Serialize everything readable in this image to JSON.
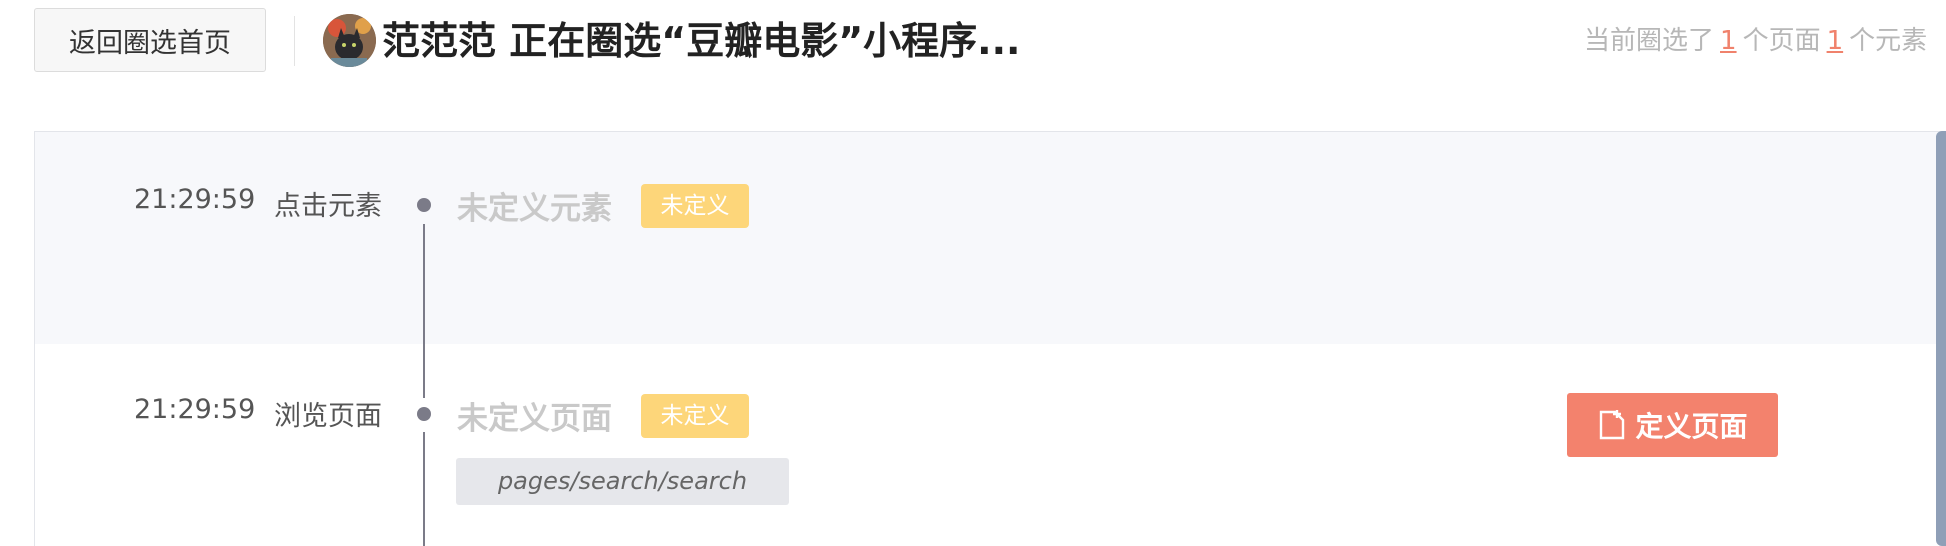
{
  "header": {
    "back_label": "返回圈选首页",
    "title": "范范范 正在圈选“豆瓣电影”小程序...",
    "summary_prefix": "当前圈选了",
    "page_count": "1",
    "summary_mid": "个页面",
    "element_count": "1",
    "summary_suffix": "个元素"
  },
  "events": [
    {
      "time": "21:29:59",
      "type": "点击元素",
      "name": "未定义元素",
      "tag": "未定义"
    },
    {
      "time": "21:29:59",
      "type": "浏览页面",
      "name": "未定义页面",
      "tag": "未定义",
      "path": "pages/search/search",
      "action_label": "定义页面"
    }
  ],
  "colors": {
    "accent": "#f3826d",
    "tag": "#fdd67a",
    "timeline": "#7b7b88"
  }
}
